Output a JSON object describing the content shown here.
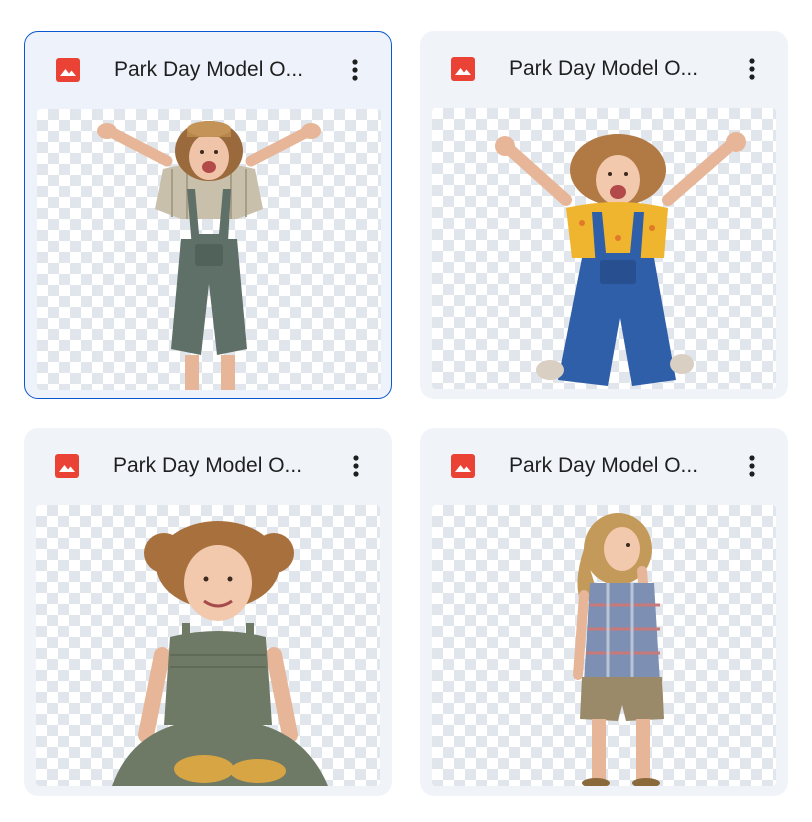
{
  "files": [
    {
      "name": "Park Day Model O...",
      "selected": true,
      "figure": "jumping-child-hat"
    },
    {
      "name": "Park Day Model O...",
      "selected": false,
      "figure": "jumping-child-denim"
    },
    {
      "name": "Park Day Model O...",
      "selected": false,
      "figure": "sitting-child"
    },
    {
      "name": "Park Day Model O...",
      "selected": false,
      "figure": "standing-child"
    }
  ],
  "icons": {
    "file_type": "image-file-icon",
    "more": "more-vert-icon"
  },
  "colors": {
    "accent": "#0b57d0",
    "image_icon": "#ea4335",
    "card_bg": "#f0f4f9"
  }
}
